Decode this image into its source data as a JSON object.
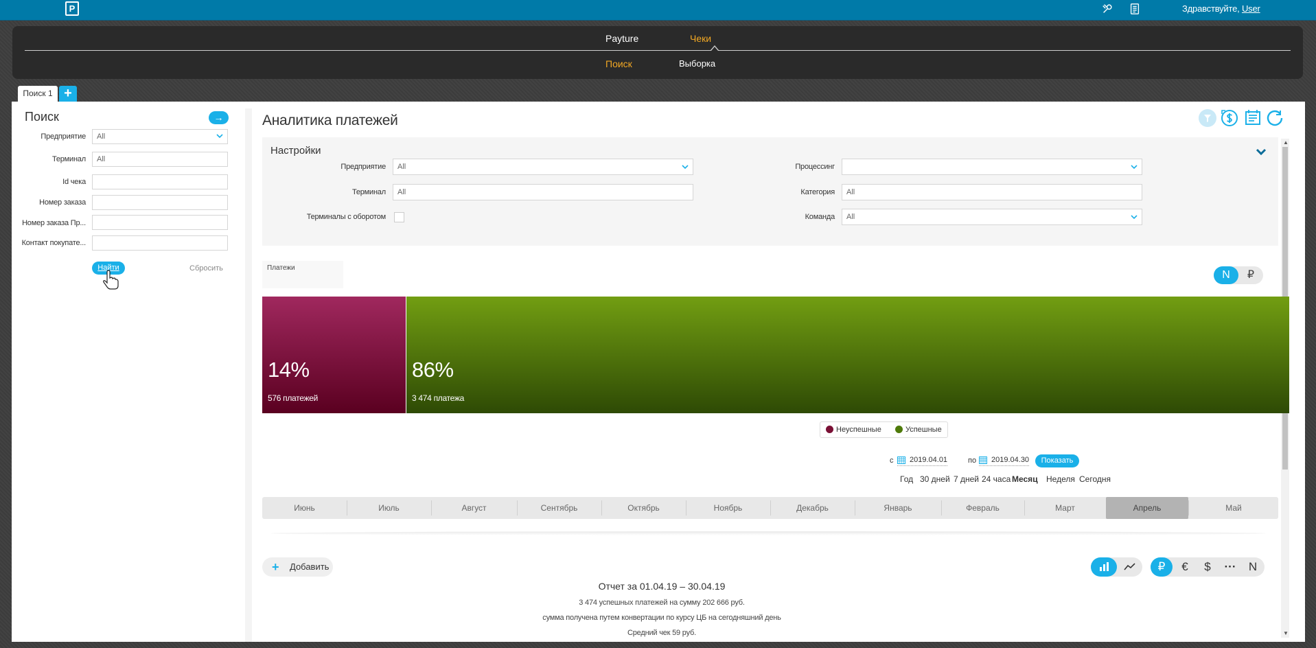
{
  "topbar": {
    "logo": "P",
    "greeting": "Здравствуйте,",
    "user": "User",
    "icons": [
      "wrench-icon",
      "document-icon"
    ]
  },
  "nav": {
    "top": [
      {
        "label": "Payture",
        "active": false
      },
      {
        "label": "Чеки",
        "active": true
      }
    ],
    "sub": [
      {
        "label": "Поиск",
        "active": true
      },
      {
        "label": "Выборка",
        "active": false
      }
    ]
  },
  "tabs": [
    {
      "label": "Поиск 1"
    }
  ],
  "sidebar": {
    "title": "Поиск",
    "fields": [
      {
        "label": "Предприятие",
        "value": "All",
        "type": "select"
      },
      {
        "label": "Терминал",
        "value": "All",
        "type": "text"
      },
      {
        "label": "Id чека",
        "value": "",
        "type": "text"
      },
      {
        "label": "Номер заказа",
        "value": "",
        "type": "text"
      },
      {
        "label": "Номер заказа Пр...",
        "value": "",
        "type": "text"
      },
      {
        "label": "Контакт покупате...",
        "value": "",
        "type": "text"
      }
    ],
    "find_label": "Найти",
    "reset_label": "Сбросить"
  },
  "main": {
    "title": "Аналитика платежей",
    "settings": {
      "title": "Настройки",
      "left": [
        {
          "label": "Предприятие",
          "value": "All",
          "type": "select"
        },
        {
          "label": "Терминал",
          "value": "All",
          "type": "text"
        },
        {
          "label": "Терминалы с оборотом",
          "value": false,
          "type": "checkbox"
        }
      ],
      "right": [
        {
          "label": "Процессинг",
          "value": "",
          "type": "select"
        },
        {
          "label": "Категория",
          "value": "All",
          "type": "text"
        },
        {
          "label": "Команда",
          "value": "All",
          "type": "select"
        }
      ]
    },
    "payments_label": "Платежи",
    "toggle": [
      "N",
      "₽"
    ],
    "toggle_active": 0,
    "legend": [
      {
        "label": "Неуспешные",
        "color": "#7a1035"
      },
      {
        "label": "Успешные",
        "color": "#4e7a0a"
      }
    ],
    "date_from_prefix": "с",
    "date_from": "2019.04.01",
    "date_to_prefix": "по",
    "date_to": "2019.04.30",
    "show_label": "Показать",
    "periods": [
      {
        "label": "Год",
        "active": false
      },
      {
        "label": "30 дней",
        "active": false
      },
      {
        "label": "7 дней",
        "active": false
      },
      {
        "label": "24 часа",
        "active": false
      },
      {
        "label": "Месяц",
        "active": true
      },
      {
        "label": "Неделя",
        "active": false
      },
      {
        "label": "Сегодня",
        "active": false
      }
    ],
    "months": [
      "Июнь",
      "Июль",
      "Август",
      "Сентябрь",
      "Октябрь",
      "Ноябрь",
      "Декабрь",
      "Январь",
      "Февраль",
      "Март",
      "Апрель",
      "Май"
    ],
    "selected_month": "Апрель",
    "add_label": "Добавить",
    "chart_type_buttons": [
      "bar-chart-icon",
      "line-chart-icon"
    ],
    "currency_buttons": [
      "₽",
      "€",
      "$",
      "···",
      "N"
    ],
    "report": {
      "title": "Отчет за 01.04.19 – 30.04.19",
      "lines": [
        "3 474 успешных платежей на сумму 202 666 руб.",
        "сумма получена путем конвертации по курсу ЦБ на сегодняшний день",
        "Средний чек 59 руб."
      ]
    }
  },
  "chart_data": {
    "type": "bar",
    "stacked": true,
    "orientation": "horizontal",
    "series": [
      {
        "name": "Неуспешные",
        "percent": 14,
        "percent_label": "14%",
        "count_label": "576 платежей",
        "color": "#7a1035"
      },
      {
        "name": "Успешные",
        "percent": 86,
        "percent_label": "86%",
        "count_label": "3 474 платежа",
        "color": "#4e7a0a"
      }
    ]
  }
}
